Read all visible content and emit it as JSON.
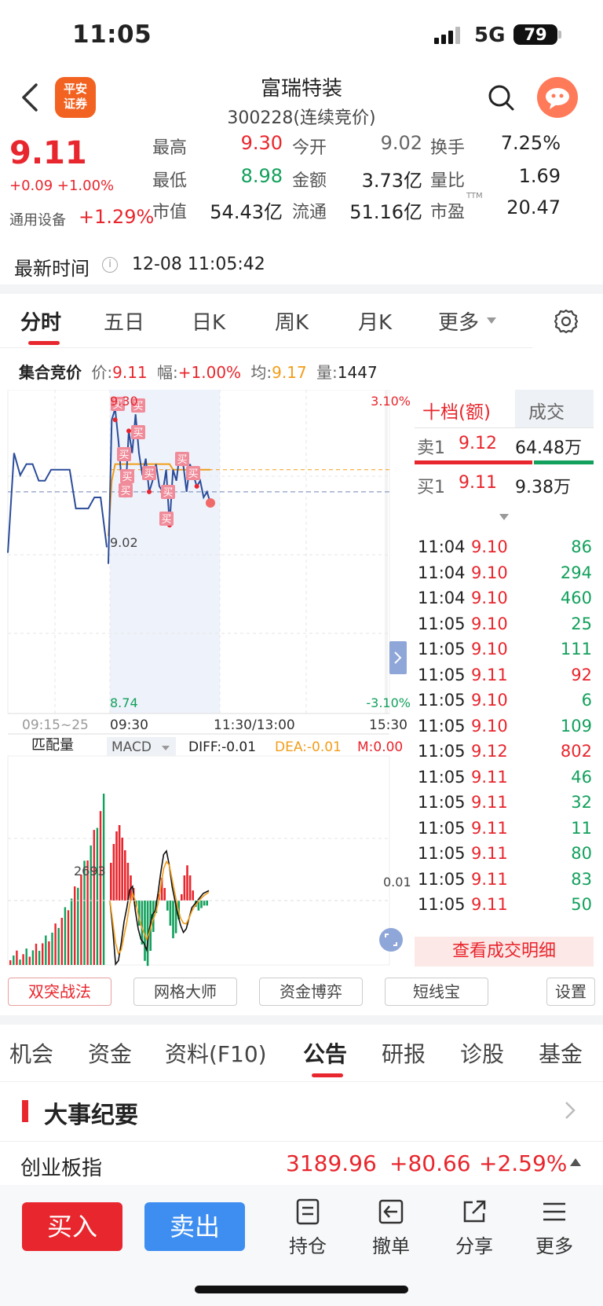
{
  "status": {
    "time": "11:05",
    "network": "5G",
    "battery": "79"
  },
  "header": {
    "logo_line1": "平安",
    "logo_line2": "证券",
    "stock_name": "富瑞特装",
    "stock_code": "300228(连续竞价)"
  },
  "quote": {
    "price": "9.11",
    "change": "+0.09 +1.00%",
    "industry_name": "通用设备",
    "industry_change": "+1.29%",
    "fields": [
      {
        "label": "最高",
        "value": "9.30",
        "color": "#e8262d"
      },
      {
        "label": "今开",
        "value": "9.02",
        "color": "#666666"
      },
      {
        "label": "换手",
        "value": "7.25%",
        "color": "#222222"
      },
      {
        "label": "最低",
        "value": "8.98",
        "color": "#12a05c"
      },
      {
        "label": "金额",
        "value": "3.73亿",
        "color": "#222222"
      },
      {
        "label": "量比",
        "value": "1.69",
        "color": "#222222"
      },
      {
        "label": "市值",
        "value": "54.43亿",
        "color": "#222222"
      },
      {
        "label": "流通",
        "value": "51.16亿",
        "color": "#222222"
      },
      {
        "label": "市盈",
        "value": "20.47",
        "color": "#222222",
        "superscript": "TTM"
      }
    ],
    "latest_time_label": "最新时间",
    "latest_time": "12-08 11:05:42"
  },
  "chart_tabs": [
    "分时",
    "五日",
    "日K",
    "周K",
    "月K",
    "更多"
  ],
  "auction": {
    "label": "集合竞价",
    "price_label": "价:",
    "price": "9.11",
    "amp_label": "幅:",
    "amp": "+1.00%",
    "avg_label": "均:",
    "avg": "9.17",
    "vol_label": "量:",
    "vol": "1447"
  },
  "chart_data": {
    "type": "line",
    "y_high_label": "9.30",
    "y_base_label": "9.02",
    "y_low_label": "8.74",
    "pct_high_label": "3.10%",
    "pct_low_label": "-3.10%",
    "x_labels": [
      "09:15~25",
      "09:30",
      "11:30/13:00",
      "15:30"
    ],
    "prev_close": 9.02,
    "ylim": [
      8.74,
      9.3
    ],
    "auction_prices": [
      9.02,
      9.2,
      9.16,
      9.18,
      9.18,
      9.15,
      9.15,
      9.17,
      9.17,
      9.17,
      9.17,
      9.1,
      9.1,
      9.1,
      9.12,
      9.12,
      9.03
    ],
    "session_prices": [
      9.0,
      9.26,
      9.28,
      9.22,
      9.14,
      9.12,
      9.24,
      9.2,
      9.27,
      9.2,
      9.16,
      9.19,
      9.13,
      9.15,
      9.18,
      9.14,
      9.13,
      9.17,
      9.07,
      9.17,
      9.15,
      9.2,
      9.18,
      9.13,
      9.18,
      9.16,
      9.14,
      9.15,
      9.12,
      9.13,
      9.11
    ],
    "avg_prices": [
      9.05,
      9.15,
      9.18,
      9.18,
      9.18,
      9.18,
      9.18,
      9.18,
      9.18,
      9.18,
      9.18,
      9.18,
      9.18,
      9.18,
      9.18,
      9.18,
      9.18,
      9.18,
      9.18,
      9.17,
      9.17,
      9.17,
      9.17,
      9.17,
      9.17,
      9.17,
      9.17,
      9.17,
      9.17,
      9.17,
      9.17
    ],
    "buy_signals": [
      "买",
      "买",
      "买",
      "买",
      "买",
      "买",
      "买",
      "买",
      "买",
      "买",
      "买"
    ],
    "macd": {
      "label": "MACD",
      "diff": "DIFF:-0.01",
      "dea": "DEA:-0.01",
      "m": "M:0.00",
      "axis_label": "0.01"
    },
    "match_volume": {
      "label": "匹配量",
      "axis_label": "2693"
    }
  },
  "order_book": {
    "tab_active": "十档(额)",
    "tab_other": "成交",
    "sell1": {
      "label": "卖1",
      "price": "9.12",
      "amount": "64.48万"
    },
    "buy1": {
      "label": "买1",
      "price": "9.11",
      "amount": "9.38万"
    },
    "trades": [
      {
        "time": "11:04",
        "price": "9.10",
        "vol": "86",
        "pc": "#e8262d",
        "vc": "#12a05c"
      },
      {
        "time": "11:04",
        "price": "9.10",
        "vol": "294",
        "pc": "#e8262d",
        "vc": "#12a05c"
      },
      {
        "time": "11:04",
        "price": "9.10",
        "vol": "460",
        "pc": "#e8262d",
        "vc": "#12a05c"
      },
      {
        "time": "11:05",
        "price": "9.10",
        "vol": "25",
        "pc": "#e8262d",
        "vc": "#12a05c"
      },
      {
        "time": "11:05",
        "price": "9.10",
        "vol": "111",
        "pc": "#e8262d",
        "vc": "#12a05c"
      },
      {
        "time": "11:05",
        "price": "9.11",
        "vol": "92",
        "pc": "#e8262d",
        "vc": "#e8262d"
      },
      {
        "time": "11:05",
        "price": "9.10",
        "vol": "6",
        "pc": "#e8262d",
        "vc": "#12a05c"
      },
      {
        "time": "11:05",
        "price": "9.10",
        "vol": "109",
        "pc": "#e8262d",
        "vc": "#12a05c"
      },
      {
        "time": "11:05",
        "price": "9.12",
        "vol": "802",
        "pc": "#e8262d",
        "vc": "#e8262d"
      },
      {
        "time": "11:05",
        "price": "9.11",
        "vol": "46",
        "pc": "#e8262d",
        "vc": "#12a05c"
      },
      {
        "time": "11:05",
        "price": "9.11",
        "vol": "32",
        "pc": "#e8262d",
        "vc": "#12a05c"
      },
      {
        "time": "11:05",
        "price": "9.11",
        "vol": "11",
        "pc": "#e8262d",
        "vc": "#12a05c"
      },
      {
        "time": "11:05",
        "price": "9.11",
        "vol": "80",
        "pc": "#e8262d",
        "vc": "#12a05c"
      },
      {
        "time": "11:05",
        "price": "9.11",
        "vol": "83",
        "pc": "#e8262d",
        "vc": "#12a05c"
      },
      {
        "time": "11:05",
        "price": "9.11",
        "vol": "50",
        "pc": "#e8262d",
        "vc": "#12a05c"
      }
    ],
    "view_detail": "查看成交明细"
  },
  "tools": [
    "双突战法",
    "网格大师",
    "资金博弈",
    "短线宝",
    "设置"
  ],
  "bottom_tabs": [
    "机会",
    "资金",
    "资料(F10)",
    "公告",
    "研报",
    "诊股",
    "基金"
  ],
  "events_title": "大事纪要",
  "index": {
    "name": "创业板指",
    "value": "3189.96",
    "change": "+80.66",
    "pct": "+2.59%"
  },
  "footer": {
    "buy": "买入",
    "sell": "卖出",
    "items": [
      "持仓",
      "撤单",
      "分享",
      "更多"
    ]
  },
  "colors": {
    "up": "#e8262d",
    "down": "#12a05c",
    "line": "#2b4c9a",
    "avg": "#f29d1a",
    "brand": "#f26322"
  }
}
